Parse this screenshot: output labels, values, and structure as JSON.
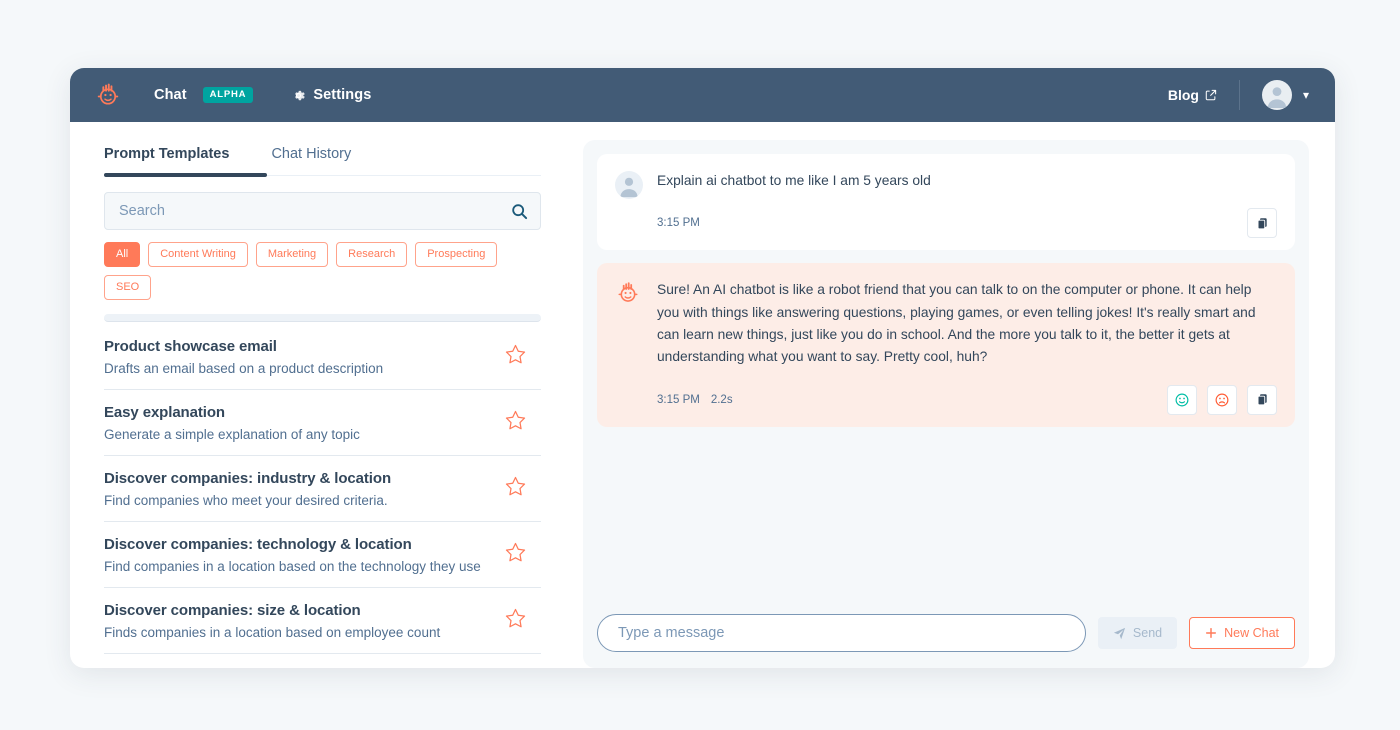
{
  "nav": {
    "logo_icon": "robot-face-logo",
    "chat_label": "Chat",
    "alpha_badge": "ALPHA",
    "settings_icon": "gear-icon",
    "settings_label": "Settings",
    "blog_label": "Blog",
    "blog_external_icon": "external-link-icon",
    "avatar_icon": "user-avatar-icon",
    "chevron_icon": "chevron-down-icon"
  },
  "left": {
    "tabs": [
      {
        "label": "Prompt Templates",
        "active": true
      },
      {
        "label": "Chat History",
        "active": false
      }
    ],
    "search": {
      "placeholder": "Search",
      "value": "",
      "icon": "search-icon"
    },
    "chips": [
      {
        "label": "All",
        "active": true
      },
      {
        "label": "Content Writing",
        "active": false
      },
      {
        "label": "Marketing",
        "active": false
      },
      {
        "label": "Research",
        "active": false
      },
      {
        "label": "Prospecting",
        "active": false
      },
      {
        "label": "SEO",
        "active": false
      }
    ],
    "templates": [
      {
        "title": "Product showcase email",
        "desc": "Drafts an email based on a product description",
        "star_icon": "star-outline-icon"
      },
      {
        "title": "Easy explanation",
        "desc": "Generate a simple explanation of any topic",
        "star_icon": "star-outline-icon"
      },
      {
        "title": "Discover companies: industry & location",
        "desc": "Find companies who meet your desired criteria.",
        "star_icon": "star-outline-icon"
      },
      {
        "title": "Discover companies: technology & location",
        "desc": "Find companies in a location based on the technology they use",
        "star_icon": "star-outline-icon"
      },
      {
        "title": "Discover companies: size & location",
        "desc": "Finds companies in a location based on employee count",
        "star_icon": "star-outline-icon"
      }
    ]
  },
  "chat": {
    "messages": [
      {
        "role": "user",
        "avatar_icon": "user-avatar-icon",
        "text": "Explain ai chatbot to me like I am 5 years old",
        "time": "3:15 PM",
        "duration": "",
        "actions": [
          {
            "icon": "copy-icon",
            "name": "copy-button"
          }
        ]
      },
      {
        "role": "bot",
        "avatar_icon": "robot-face-logo",
        "text": "Sure! An AI chatbot is like a robot friend that you can talk to on the computer or phone. It can help you with things like answering questions, playing games, or even telling jokes! It's really smart and can learn new things, just like you do in school. And the more you talk to it, the better it gets at understanding what you want to say. Pretty cool, huh?",
        "time": "3:15 PM",
        "duration": "2.2s",
        "actions": [
          {
            "icon": "thumbs-up-smiley-icon",
            "name": "feedback-positive-button"
          },
          {
            "icon": "thumbs-down-frown-icon",
            "name": "feedback-negative-button"
          },
          {
            "icon": "copy-icon",
            "name": "copy-button"
          }
        ]
      }
    ],
    "composer": {
      "placeholder": "Type a message",
      "value": "",
      "send_label": "Send",
      "send_icon": "paper-plane-icon",
      "newchat_label": "New Chat",
      "newchat_icon": "plus-icon"
    }
  },
  "colors": {
    "nav_bg": "#425B76",
    "accent": "#FF7A59",
    "badge_teal": "#00A4A0",
    "text_dark": "#33475B",
    "text_muted": "#516F90",
    "bot_bubble": "#FDEDE7",
    "page_bg": "#F5F8FA"
  }
}
